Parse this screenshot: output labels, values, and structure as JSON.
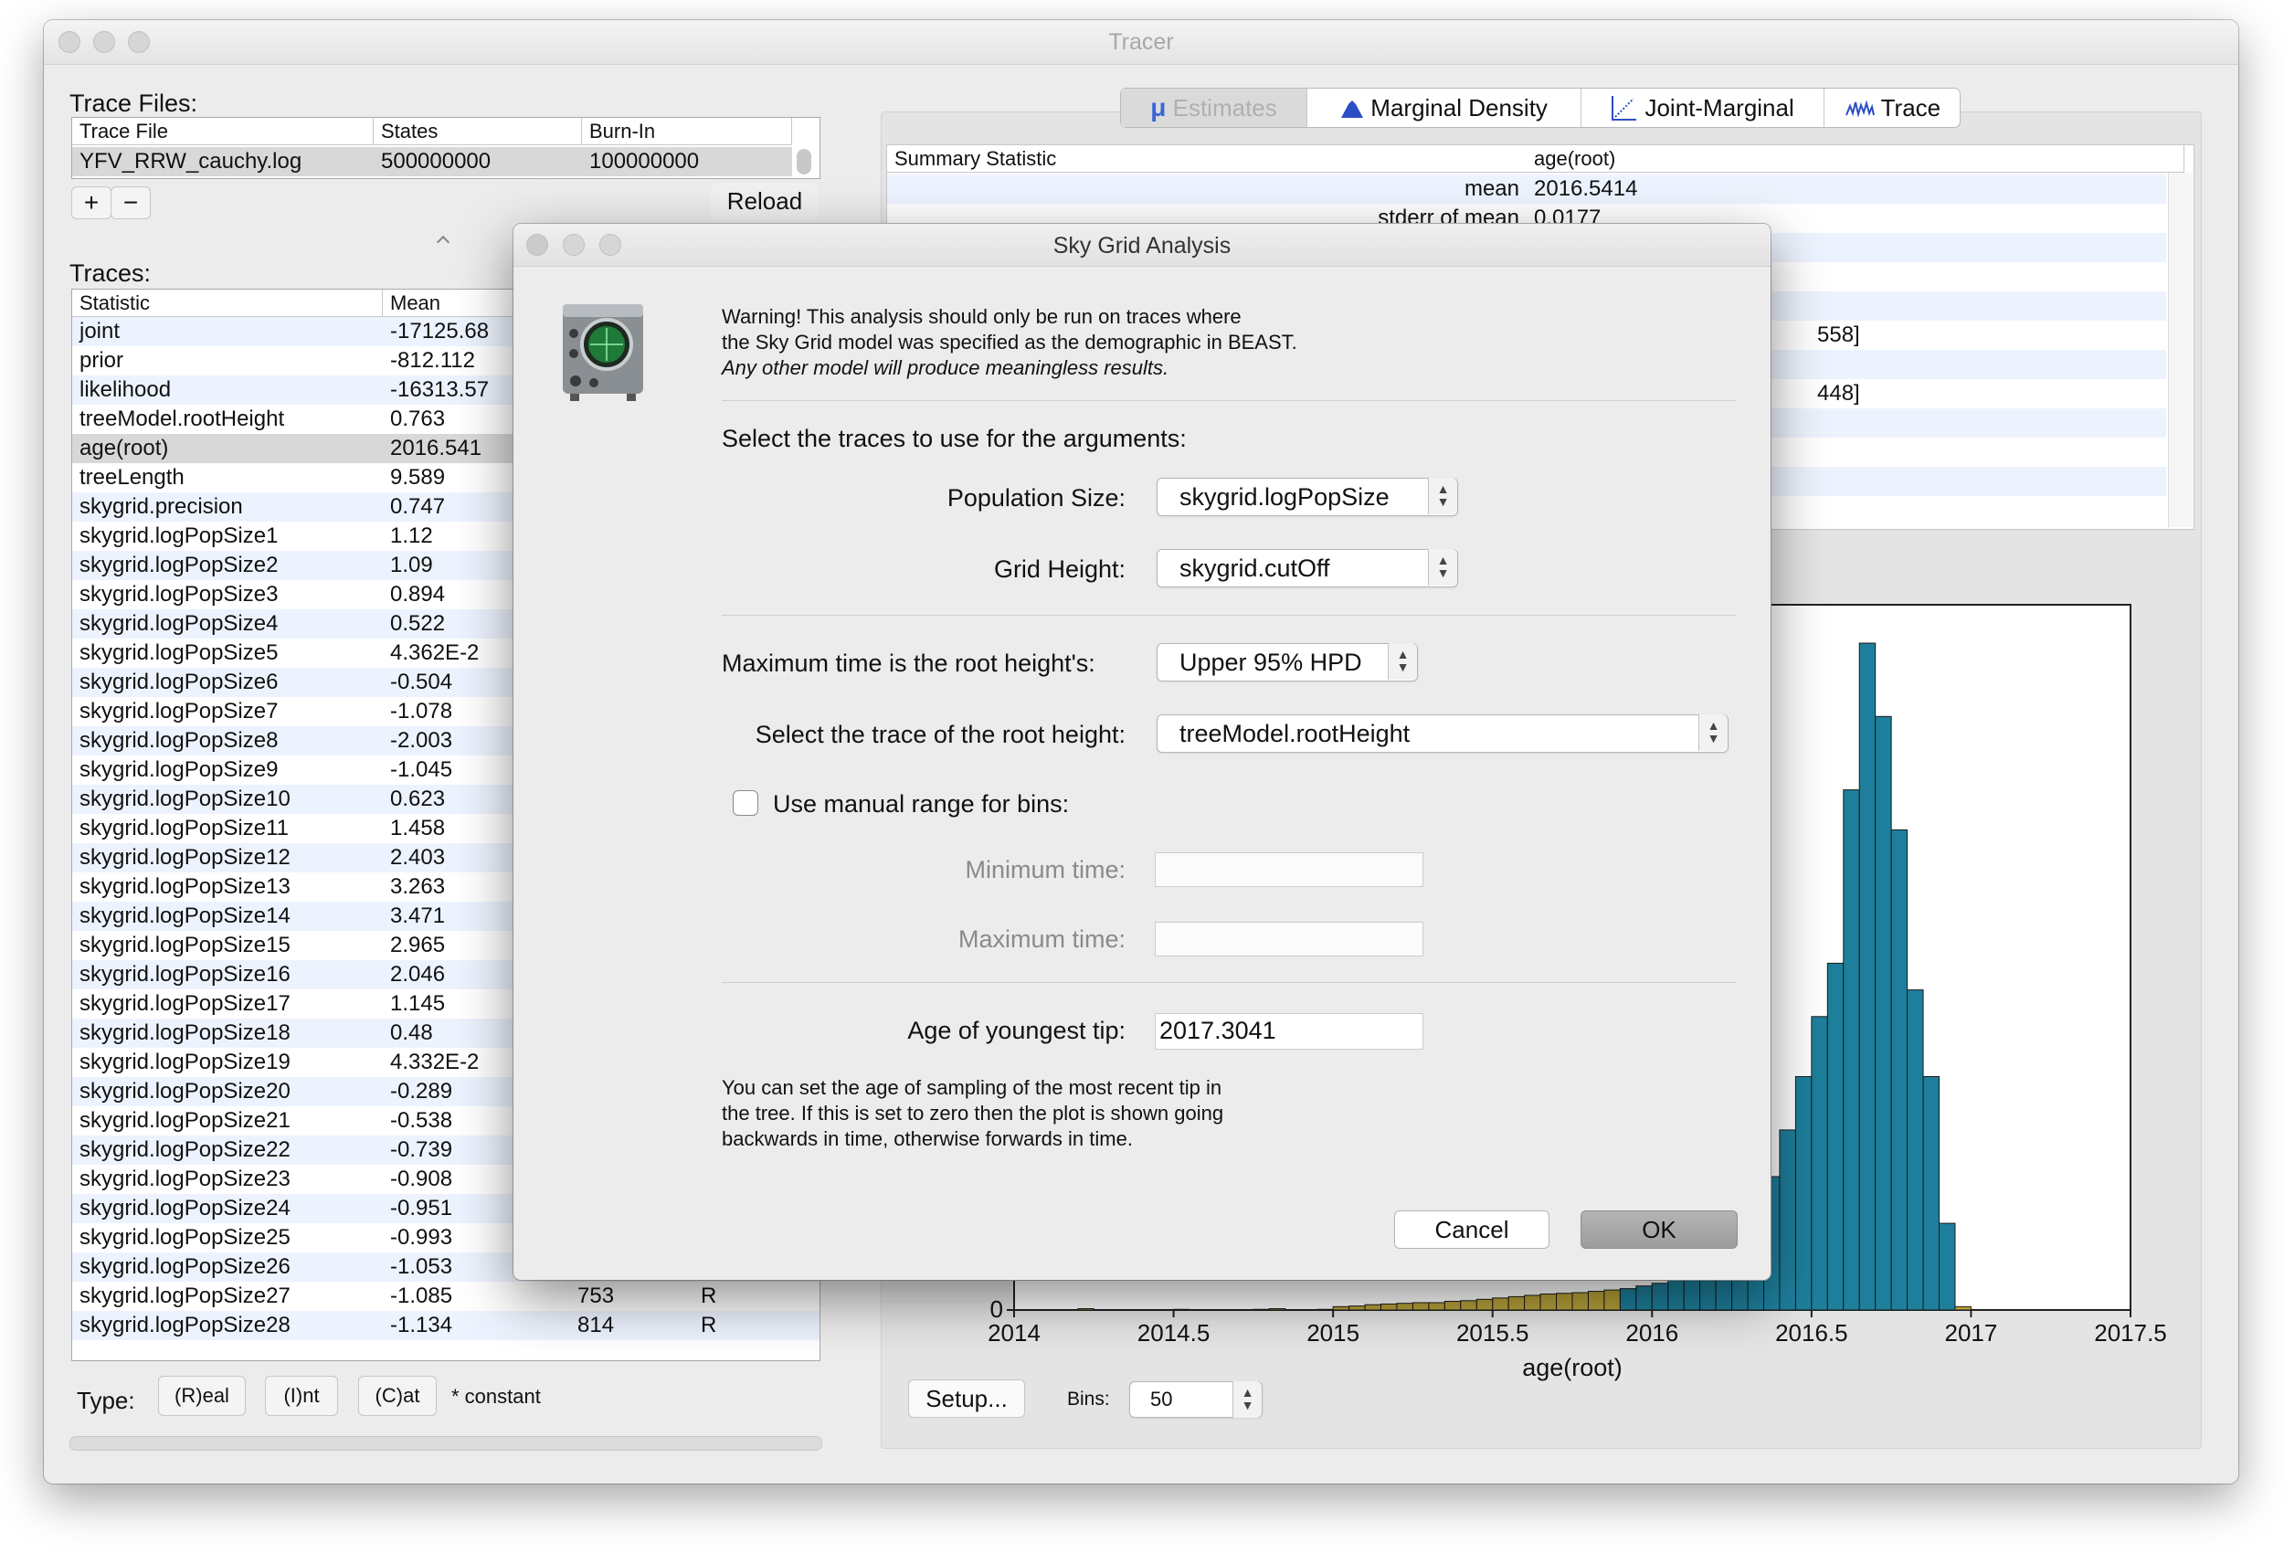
{
  "window": {
    "title": "Tracer"
  },
  "trace_files": {
    "label": "Trace Files:",
    "columns": [
      "Trace File",
      "States",
      "Burn-In"
    ],
    "rows": [
      {
        "file": "YFV_RRW_cauchy.log",
        "states": "500000000",
        "burnin": "100000000"
      }
    ],
    "add_label": "+",
    "remove_label": "−",
    "reload_label": "Reload"
  },
  "traces": {
    "label": "Traces:",
    "columns": [
      "Statistic",
      "Mean"
    ],
    "rows": [
      {
        "stat": "joint",
        "mean": "-17125.68"
      },
      {
        "stat": "prior",
        "mean": "-812.112"
      },
      {
        "stat": "likelihood",
        "mean": "-16313.57"
      },
      {
        "stat": "treeModel.rootHeight",
        "mean": "0.763"
      },
      {
        "stat": "age(root)",
        "mean": "2016.541"
      },
      {
        "stat": "treeLength",
        "mean": "9.589"
      },
      {
        "stat": "skygrid.precision",
        "mean": "0.747"
      },
      {
        "stat": "skygrid.logPopSize1",
        "mean": "1.12"
      },
      {
        "stat": "skygrid.logPopSize2",
        "mean": "1.09"
      },
      {
        "stat": "skygrid.logPopSize3",
        "mean": "0.894"
      },
      {
        "stat": "skygrid.logPopSize4",
        "mean": "0.522"
      },
      {
        "stat": "skygrid.logPopSize5",
        "mean": "4.362E-2"
      },
      {
        "stat": "skygrid.logPopSize6",
        "mean": "-0.504"
      },
      {
        "stat": "skygrid.logPopSize7",
        "mean": "-1.078"
      },
      {
        "stat": "skygrid.logPopSize8",
        "mean": "-2.003"
      },
      {
        "stat": "skygrid.logPopSize9",
        "mean": "-1.045"
      },
      {
        "stat": "skygrid.logPopSize10",
        "mean": "0.623"
      },
      {
        "stat": "skygrid.logPopSize11",
        "mean": "1.458"
      },
      {
        "stat": "skygrid.logPopSize12",
        "mean": "2.403"
      },
      {
        "stat": "skygrid.logPopSize13",
        "mean": "3.263"
      },
      {
        "stat": "skygrid.logPopSize14",
        "mean": "3.471"
      },
      {
        "stat": "skygrid.logPopSize15",
        "mean": "2.965"
      },
      {
        "stat": "skygrid.logPopSize16",
        "mean": "2.046"
      },
      {
        "stat": "skygrid.logPopSize17",
        "mean": "1.145"
      },
      {
        "stat": "skygrid.logPopSize18",
        "mean": "0.48"
      },
      {
        "stat": "skygrid.logPopSize19",
        "mean": "4.332E-2"
      },
      {
        "stat": "skygrid.logPopSize20",
        "mean": "-0.289"
      },
      {
        "stat": "skygrid.logPopSize21",
        "mean": "-0.538"
      },
      {
        "stat": "skygrid.logPopSize22",
        "mean": "-0.739"
      },
      {
        "stat": "skygrid.logPopSize23",
        "mean": "-0.908"
      },
      {
        "stat": "skygrid.logPopSize24",
        "mean": "-0.951"
      },
      {
        "stat": "skygrid.logPopSize25",
        "mean": "-0.993"
      },
      {
        "stat": "skygrid.logPopSize26",
        "mean": "-1.053"
      },
      {
        "stat": "skygrid.logPopSize27",
        "mean": "-1.085",
        "ess": "753",
        "type": "R"
      },
      {
        "stat": "skygrid.logPopSize28",
        "mean": "-1.134",
        "ess": "814",
        "type": "R"
      }
    ],
    "type_label": "Type:",
    "type_real": "(R)eal",
    "type_int": "(I)nt",
    "type_cat": "(C)at",
    "constant_note": "* constant"
  },
  "tabs": [
    {
      "label": "Estimates",
      "icon": "mu-icon",
      "disabled": true
    },
    {
      "label": "Marginal Density",
      "icon": "density-icon"
    },
    {
      "label": "Joint-Marginal",
      "icon": "joint-marginal-icon"
    },
    {
      "label": "Trace",
      "icon": "trace-icon"
    }
  ],
  "summary": {
    "columns": [
      "Summary Statistic",
      "age(root)"
    ],
    "rows": [
      {
        "stat": "mean",
        "value": "2016.5414"
      },
      {
        "stat": "stderr of mean",
        "value": "0.0177"
      }
    ],
    "partial_values": [
      "558]",
      "448]"
    ]
  },
  "chart_data": {
    "type": "bar",
    "xlabel": "age(root)",
    "xlim": [
      2014,
      2017.5
    ],
    "xticks": [
      "2014",
      "2014.5",
      "2015",
      "2015.5",
      "2016",
      "2016.5",
      "2017",
      "2017.5"
    ],
    "yticks": [
      "0"
    ],
    "bin_width": 0.05,
    "series": [
      {
        "color": "#b8a13a",
        "bins": [
          {
            "x": 2014.2,
            "value": 0.2
          },
          {
            "x": 2014.5,
            "value": 0.1
          },
          {
            "x": 2014.75,
            "value": 0.1
          },
          {
            "x": 2014.8,
            "value": 0.2
          },
          {
            "x": 2014.95,
            "value": 0.1
          },
          {
            "x": 2015.0,
            "value": 0.5
          },
          {
            "x": 2015.05,
            "value": 0.6
          },
          {
            "x": 2015.1,
            "value": 0.8
          },
          {
            "x": 2015.15,
            "value": 0.9
          },
          {
            "x": 2015.2,
            "value": 1.0
          },
          {
            "x": 2015.25,
            "value": 1.1
          },
          {
            "x": 2015.3,
            "value": 1.1
          },
          {
            "x": 2015.35,
            "value": 1.3
          },
          {
            "x": 2015.4,
            "value": 1.4
          },
          {
            "x": 2015.45,
            "value": 1.6
          },
          {
            "x": 2015.5,
            "value": 1.8
          },
          {
            "x": 2015.55,
            "value": 2.0
          },
          {
            "x": 2015.6,
            "value": 2.2
          },
          {
            "x": 2015.65,
            "value": 2.4
          },
          {
            "x": 2015.7,
            "value": 2.5
          },
          {
            "x": 2015.75,
            "value": 2.6
          },
          {
            "x": 2015.8,
            "value": 2.8
          },
          {
            "x": 2015.85,
            "value": 3.0
          },
          {
            "x": 2016.95,
            "value": 0.5
          }
        ]
      },
      {
        "color": "#1d7f9c",
        "bins": [
          {
            "x": 2015.9,
            "value": 3.2
          },
          {
            "x": 2015.95,
            "value": 3.6
          },
          {
            "x": 2016.0,
            "value": 4.0
          },
          {
            "x": 2016.05,
            "value": 4.6
          },
          {
            "x": 2016.1,
            "value": 5.5
          },
          {
            "x": 2016.15,
            "value": 6.8
          },
          {
            "x": 2016.2,
            "value": 8.5
          },
          {
            "x": 2016.25,
            "value": 11
          },
          {
            "x": 2016.3,
            "value": 15
          },
          {
            "x": 2016.35,
            "value": 20
          },
          {
            "x": 2016.4,
            "value": 27
          },
          {
            "x": 2016.45,
            "value": 35
          },
          {
            "x": 2016.5,
            "value": 44
          },
          {
            "x": 2016.55,
            "value": 52
          },
          {
            "x": 2016.6,
            "value": 78
          },
          {
            "x": 2016.65,
            "value": 100
          },
          {
            "x": 2016.7,
            "value": 89
          },
          {
            "x": 2016.75,
            "value": 72
          },
          {
            "x": 2016.8,
            "value": 48
          },
          {
            "x": 2016.85,
            "value": 35
          },
          {
            "x": 2016.9,
            "value": 13
          }
        ]
      }
    ]
  },
  "bottom": {
    "setup_label": "Setup...",
    "bins_label": "Bins:",
    "bins_value": "50"
  },
  "dialog": {
    "title": "Sky Grid Analysis",
    "warning_line1": "Warning! This analysis should only be run on traces where",
    "warning_line2": "the Sky Grid model was specified as the demographic in BEAST.",
    "warning_line3": "Any other model will produce meaningless results.",
    "select_heading": "Select the traces to use for the arguments:",
    "pop_size_label": "Population Size:",
    "pop_size_value": "skygrid.logPopSize",
    "grid_height_label": "Grid Height:",
    "grid_height_value": "skygrid.cutOff",
    "max_time_label": "Maximum time is the root height's:",
    "max_time_value": "Upper 95% HPD",
    "root_trace_label": "Select the trace of the root height:",
    "root_trace_value": "treeModel.rootHeight",
    "manual_range_label": "Use manual range for bins:",
    "min_time_label": "Minimum time:",
    "min_time_value": "",
    "max_time_field_label": "Maximum time:",
    "max_time_field_value": "",
    "youngest_tip_label": "Age of youngest tip:",
    "youngest_tip_value": "2017.3041",
    "help_line1": "You can set the age of sampling of the most recent tip in",
    "help_line2": "the tree. If this is set to zero then the plot is shown going",
    "help_line3": "backwards in time, otherwise forwards in time.",
    "cancel_label": "Cancel",
    "ok_label": "OK"
  }
}
